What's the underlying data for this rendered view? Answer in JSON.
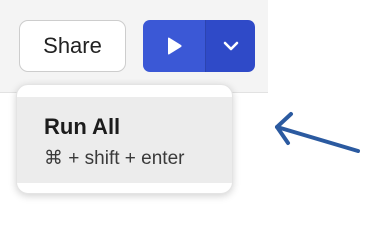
{
  "toolbar": {
    "share_label": "Share",
    "run_icon": "play-icon",
    "menu_toggle_icon": "chevron-down-icon"
  },
  "dropdown": {
    "items": [
      {
        "label": "Run All",
        "shortcut": "⌘ + shift + enter"
      }
    ]
  },
  "annotation": {
    "icon": "arrow-left-icon",
    "color": "#2b5aa0"
  },
  "colors": {
    "run_button": "#3b58d6",
    "run_menu_toggle": "#2f4ac8",
    "menu_item_highlight": "#ececec"
  }
}
